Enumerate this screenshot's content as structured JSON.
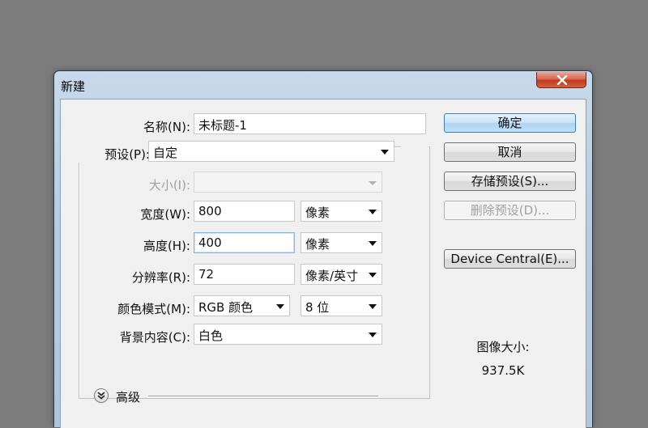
{
  "dialog": {
    "title": "新建"
  },
  "fields": {
    "name": {
      "label": "名称(N):",
      "value": "未标题-1"
    },
    "preset": {
      "label": "预设(P):",
      "value": "自定"
    },
    "size": {
      "label": "大小(I):",
      "value": ""
    },
    "width": {
      "label": "宽度(W):",
      "value": "800",
      "unit": "像素"
    },
    "height": {
      "label": "高度(H):",
      "value": "400",
      "unit": "像素"
    },
    "resolution": {
      "label": "分辨率(R):",
      "value": "72",
      "unit": "像素/英寸"
    },
    "color_mode": {
      "label": "颜色模式(M):",
      "value": "RGB 颜色",
      "depth": "8 位"
    },
    "background": {
      "label": "背景内容(C):",
      "value": "白色"
    }
  },
  "advanced": {
    "label": "高级"
  },
  "buttons": {
    "ok": "确定",
    "cancel": "取消",
    "save_preset": "存储预设(S)...",
    "delete_preset": "删除预设(D)...",
    "device_central": "Device Central(E)..."
  },
  "image_size": {
    "label": "图像大小:",
    "value": "937.5K"
  },
  "colors": {
    "background": "#7b7b7b",
    "dialog_face": "#f0f0f0",
    "title_gradient": "#b7cde3",
    "close_button": "#c2391c",
    "default_button_border": "#3c7fb1",
    "focus_border": "#7eb4ea"
  }
}
